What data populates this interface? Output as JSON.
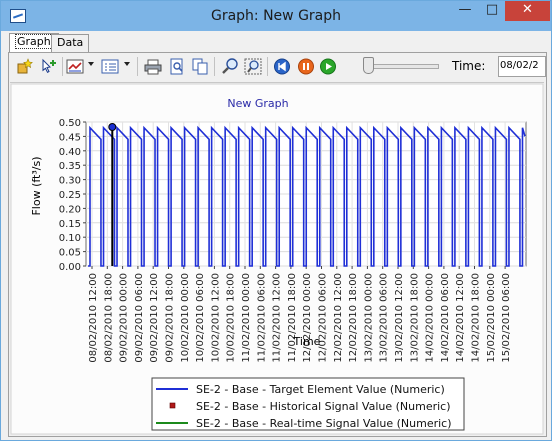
{
  "window": {
    "title": "Graph: New Graph",
    "min_glyph": "—",
    "max_glyph": "□",
    "close_glyph": "✕"
  },
  "tabs": [
    {
      "label": "Graph"
    },
    {
      "label": "Data"
    }
  ],
  "toolbar": {
    "time_label": "Time:",
    "time_value": "08/02/2",
    "icons": [
      "add-element-icon",
      "select-pointer-icon",
      "line-style-icon",
      "legend-list-icon",
      "print-icon",
      "print-preview-icon",
      "copy-icon",
      "zoom-icon",
      "zoom-region-icon",
      "rewind-icon",
      "pause-icon",
      "play-icon"
    ]
  },
  "chart_data": {
    "type": "line",
    "title": "New Graph",
    "xlabel": "Time",
    "ylabel": "Flow (ft³/s)",
    "ylim": [
      0.0,
      0.5
    ],
    "yticks": [
      "0.00",
      "0.05",
      "0.10",
      "0.15",
      "0.20",
      "0.25",
      "0.30",
      "0.35",
      "0.40",
      "0.45",
      "0.50"
    ],
    "xticks": [
      "08/02/2010 12:00",
      "08/02/2010 18:00",
      "09/02/2010 00:00",
      "09/02/2010 06:00",
      "09/02/2010 12:00",
      "09/02/2010 18:00",
      "10/02/2010 00:00",
      "10/02/2010 06:00",
      "10/02/2010 12:00",
      "10/02/2010 18:00",
      "11/02/2010 00:00",
      "11/02/2010 06:00",
      "11/02/2010 12:00",
      "11/02/2010 18:00",
      "12/02/2010 00:00",
      "12/02/2010 06:00",
      "12/02/2010 12:00",
      "12/02/2010 18:00",
      "13/02/2010 00:00",
      "13/02/2010 06:00",
      "13/02/2010 12:00",
      "13/02/2010 18:00",
      "14/02/2010 00:00",
      "14/02/2010 06:00",
      "14/02/2010 12:00",
      "14/02/2010 18:00",
      "15/02/2010 00:00",
      "15/02/2010 06:00"
    ],
    "cursor_time": "08/02/2010 18:00",
    "grid": true,
    "legend_placement": "bottom",
    "series": [
      {
        "name": "SE-2 - Base - Target Element Value (Numeric)",
        "color": "#1f2fd6",
        "style": "line",
        "pattern": "repeating pump cycle: rises to 0.48, decays to about 0.44, drops to 0.00, off for about 1 hour",
        "cycle_hours": 5.3,
        "peak": 0.48,
        "trough_on": 0.44,
        "off": 0.0
      },
      {
        "name": "SE-2 - Base - Historical Signal Value (Numeric)",
        "color": "#b01818",
        "style": "marker"
      },
      {
        "name": "SE-2 - Base - Real-time Signal Value (Numeric)",
        "color": "#1c8a1c",
        "style": "line"
      }
    ]
  }
}
